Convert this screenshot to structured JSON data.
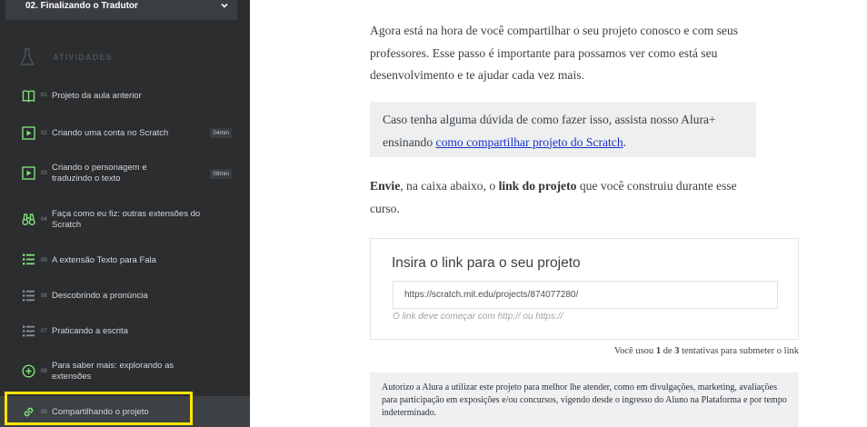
{
  "sidebar": {
    "section_title": "02. Finalizando o Tradutor",
    "activities_label": "ATIVIDADES",
    "activities": [
      {
        "num": "01",
        "title": "Projeto da aula anterior",
        "duration": "",
        "icon": "book-icon"
      },
      {
        "num": "02",
        "title": "Criando uma conta no Scratch",
        "duration": "04min",
        "icon": "play-video-icon"
      },
      {
        "num": "03",
        "title": "Criando o personagem e traduzindo o texto",
        "duration": "09min",
        "icon": "play-video-icon"
      },
      {
        "num": "04",
        "title": "Faça como eu fiz: outras extensões do Scratch",
        "duration": "",
        "icon": "binoculars-icon"
      },
      {
        "num": "05",
        "title": "A extensão Texto para Fala",
        "duration": "",
        "icon": "list-icon"
      },
      {
        "num": "06",
        "title": "Descobrindo a pronúncia",
        "duration": "",
        "icon": "list-icon"
      },
      {
        "num": "07",
        "title": "Praticando a escrita",
        "duration": "",
        "icon": "list-icon"
      },
      {
        "num": "08",
        "title": "Para saber mais: explorando as extensões",
        "duration": "",
        "icon": "plus-circle-icon"
      },
      {
        "num": "09",
        "title": "Compartilhando o projeto",
        "duration": "",
        "icon": "link-icon"
      }
    ]
  },
  "main": {
    "intro_paragraph": "Agora está na hora de você compartilhar o seu projeto conosco e com seus professores. Esse passo é importante para possamos ver como está seu desenvolvimento e te ajudar cada vez mais.",
    "callout_text": "Caso tenha alguma dúvida de como fazer isso, assista nosso Alura+ ensinando ",
    "callout_link": "como compartilhar projeto do Scratch",
    "callout_end": ".",
    "send_bold": "Envie",
    "send_text_1": ", na caixa abaixo, o ",
    "send_bold_2": "link do projeto",
    "send_text_2": " que você construiu durante esse curso.",
    "card_title": "Insira o link para o seu projeto",
    "input_value": "https://scratch.mit.edu/projects/874077280/",
    "input_hint": "O link deve começar com http:// ou https://",
    "attempts_prefix": "Você usou ",
    "attempts_used": "1",
    "attempts_mid": " de ",
    "attempts_total": "3",
    "attempts_suffix": " tentativas para submeter o link",
    "authorization_text": "Autorizo a Alura a utilizar este projeto para melhor lhe atender, como em divulgações, marketing, avaliações para participação em exposições e/ou concursos, vigendo desde o ingresso do Aluno na Plataforma e por tempo indeterminado."
  },
  "colors": {
    "sidebar_bg": "#2b2d2f",
    "icon_green": "#7fe07a",
    "icon_muted": "#8a9095",
    "link_blue": "#1a33c8",
    "highlight_yellow": "#ffe600"
  }
}
